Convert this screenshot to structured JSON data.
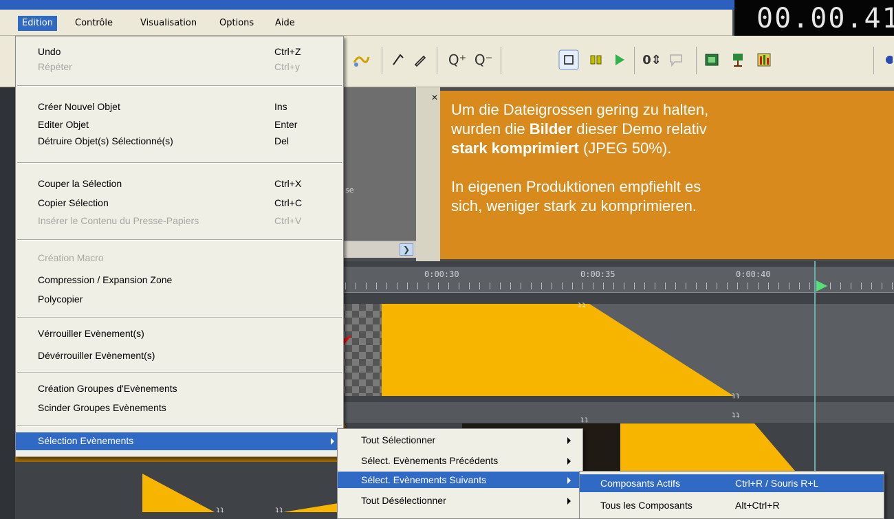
{
  "menubar": {
    "items": [
      "Edition",
      "Contrôle",
      "Visualisation",
      "Options",
      "Aide"
    ]
  },
  "timecode": "00.00.41",
  "graypanel": {
    "text": "se"
  },
  "info": {
    "line1": "Um die Dateigrossen gering zu halten,",
    "line2a": "wurden die ",
    "line2b": "Bilder",
    "line2c": " dieser Demo relativ",
    "line3a": "stark komprimiert",
    "line3b": " (JPEG 50%).",
    "line4": "In eigenen Produktionen empfiehlt es",
    "line5": "sich, weniger stark zu komprimieren."
  },
  "ruler": {
    "labels": [
      "0:00:30",
      "0:00:35",
      "0:00:40"
    ]
  },
  "edition_menu": {
    "items": [
      {
        "label": "Undo",
        "shortcut": "Ctrl+Z"
      },
      {
        "label": "Répéter",
        "shortcut": "Ctrl+y"
      },
      {
        "label": "Créer Nouvel Objet",
        "shortcut": "Ins"
      },
      {
        "label": "Editer Objet",
        "shortcut": "Enter"
      },
      {
        "label": "Détruire Objet(s) Sélectionné(s)",
        "shortcut": "Del"
      },
      {
        "label": "Couper la Sélection",
        "shortcut": "Ctrl+X"
      },
      {
        "label": "Copier Sélection",
        "shortcut": "Ctrl+C"
      },
      {
        "label": "Insérer le Contenu du Presse-Papiers",
        "shortcut": "Ctrl+V"
      },
      {
        "label": "Création Macro",
        "shortcut": ""
      },
      {
        "label": "Compression / Expansion Zone",
        "shortcut": ""
      },
      {
        "label": "Polycopier",
        "shortcut": ""
      },
      {
        "label": "Vérrouiller Evènement(s)",
        "shortcut": ""
      },
      {
        "label": "Dévérrouiller Evènement(s)",
        "shortcut": ""
      },
      {
        "label": "Création Groupes d'Evènements",
        "shortcut": ""
      },
      {
        "label": "Scinder Groupes Evènements",
        "shortcut": ""
      },
      {
        "label": "Sélection Evènements",
        "shortcut": ""
      }
    ]
  },
  "selection_submenu": {
    "items": [
      {
        "label": "Tout Sélectionner"
      },
      {
        "label": "Sélect. Evènements Précédents"
      },
      {
        "label": "Sélect. Evènements Suivants"
      },
      {
        "label": "Tout Désélectionner"
      }
    ]
  },
  "suivants_submenu": {
    "items": [
      {
        "label": "Composants Actifs",
        "shortcut": "Ctrl+R / Souris R+L"
      },
      {
        "label": "Tous les Composants",
        "shortcut": "Alt+Ctrl+R"
      }
    ]
  },
  "toolbar": {
    "zoom_in_icon": "Q⁺",
    "zoom_out_icon": "Q⁻",
    "counter_label": "0⇕"
  },
  "colors": {
    "menu_highlight": "#316ac5",
    "info_box": "#d88a1c",
    "event_yellow": "#f7b500"
  }
}
